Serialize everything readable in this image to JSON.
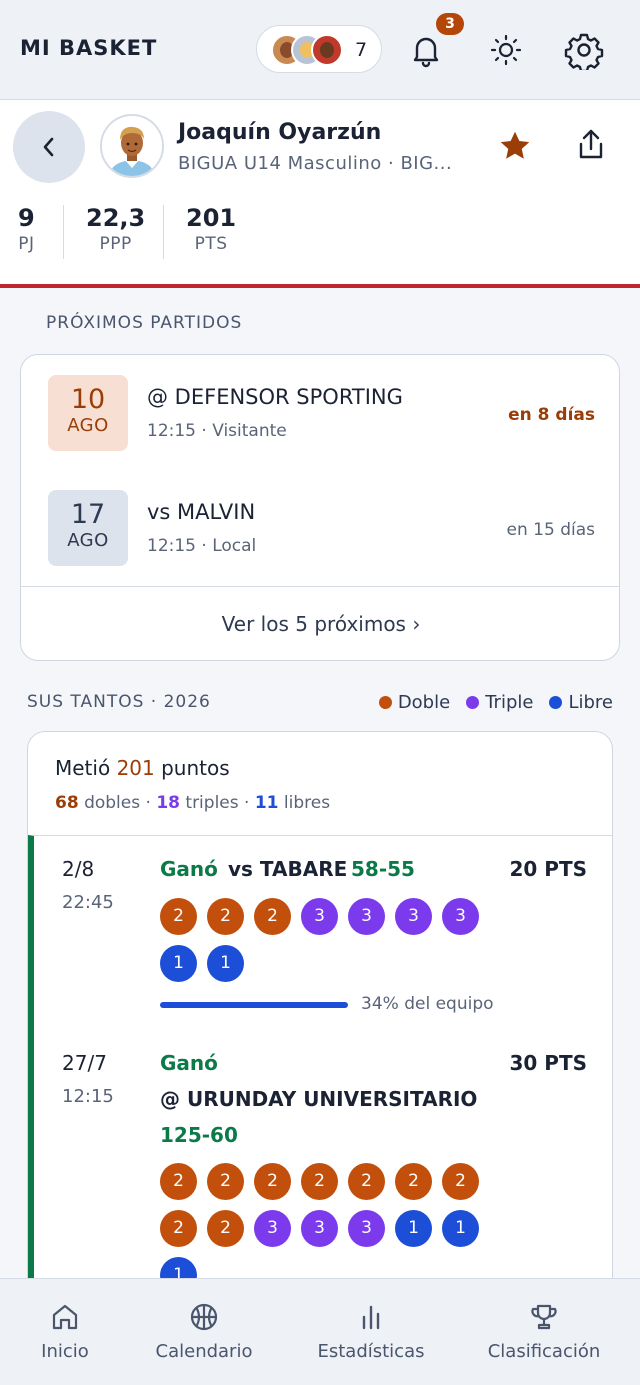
{
  "app": {
    "brand": "MI BASKET",
    "favorites_count": "7",
    "notifications_badge": "3"
  },
  "player": {
    "name": "Joaquín Oyarzún",
    "team": "BIGUA U14 Masculino · BIG...",
    "stats": [
      {
        "value": "9",
        "label": "PJ"
      },
      {
        "value": "22,3",
        "label": "PPP"
      },
      {
        "value": "201",
        "label": "PTS"
      }
    ]
  },
  "upcoming": {
    "title": "PRÓXIMOS PARTIDOS",
    "matches": [
      {
        "day": "10",
        "month": "AGO",
        "opponent": "@ DEFENSOR SPORTING",
        "meta": "12:15 · Visitante",
        "in": "en 8 días"
      },
      {
        "day": "17",
        "month": "AGO",
        "opponent": "vs MALVIN",
        "meta": "12:15 · Local",
        "in": "en 15 días"
      }
    ],
    "more_link": "Ver los 5 próximos ›"
  },
  "points": {
    "title": "SUS TANTOS · 2026",
    "legend": [
      {
        "label": "Doble",
        "color": "#c2500c"
      },
      {
        "label": "Triple",
        "color": "#7c3aed"
      },
      {
        "label": "Libre",
        "color": "#1d4ed8"
      }
    ],
    "summary_prefix": "Metió",
    "summary_total": "201",
    "summary_suffix": "puntos",
    "doubles": "68",
    "doubles_label": "dobles ·",
    "triples": "18",
    "triples_label": "triples ·",
    "frees": "11",
    "frees_label": "libres",
    "games": [
      {
        "date": "2/8",
        "time": "22:45",
        "result": "Ganó",
        "opponent": "vs TABARE",
        "score": "58-55",
        "pts": "20 PTS",
        "baskets": [
          "2",
          "2",
          "2",
          "3",
          "3",
          "3",
          "3",
          "1",
          "1"
        ],
        "team_share": 0.34,
        "team_share_label": "34% del equipo"
      },
      {
        "date": "27/7",
        "time": "12:15",
        "result": "Ganó",
        "opponent": "@ URUNDAY UNIVERSITARIO",
        "score": "125-60",
        "pts": "30 PTS",
        "baskets": [
          "2",
          "2",
          "2",
          "2",
          "2",
          "2",
          "2",
          "2",
          "2",
          "3",
          "3",
          "3",
          "1",
          "1",
          "1"
        ]
      }
    ]
  },
  "nav": [
    {
      "label": "Inicio",
      "icon": "home-icon"
    },
    {
      "label": "Calendario",
      "icon": "basketball-icon"
    },
    {
      "label": "Estadísticas",
      "icon": "bar-chart-icon"
    },
    {
      "label": "Clasificación",
      "icon": "trophy-icon"
    }
  ]
}
